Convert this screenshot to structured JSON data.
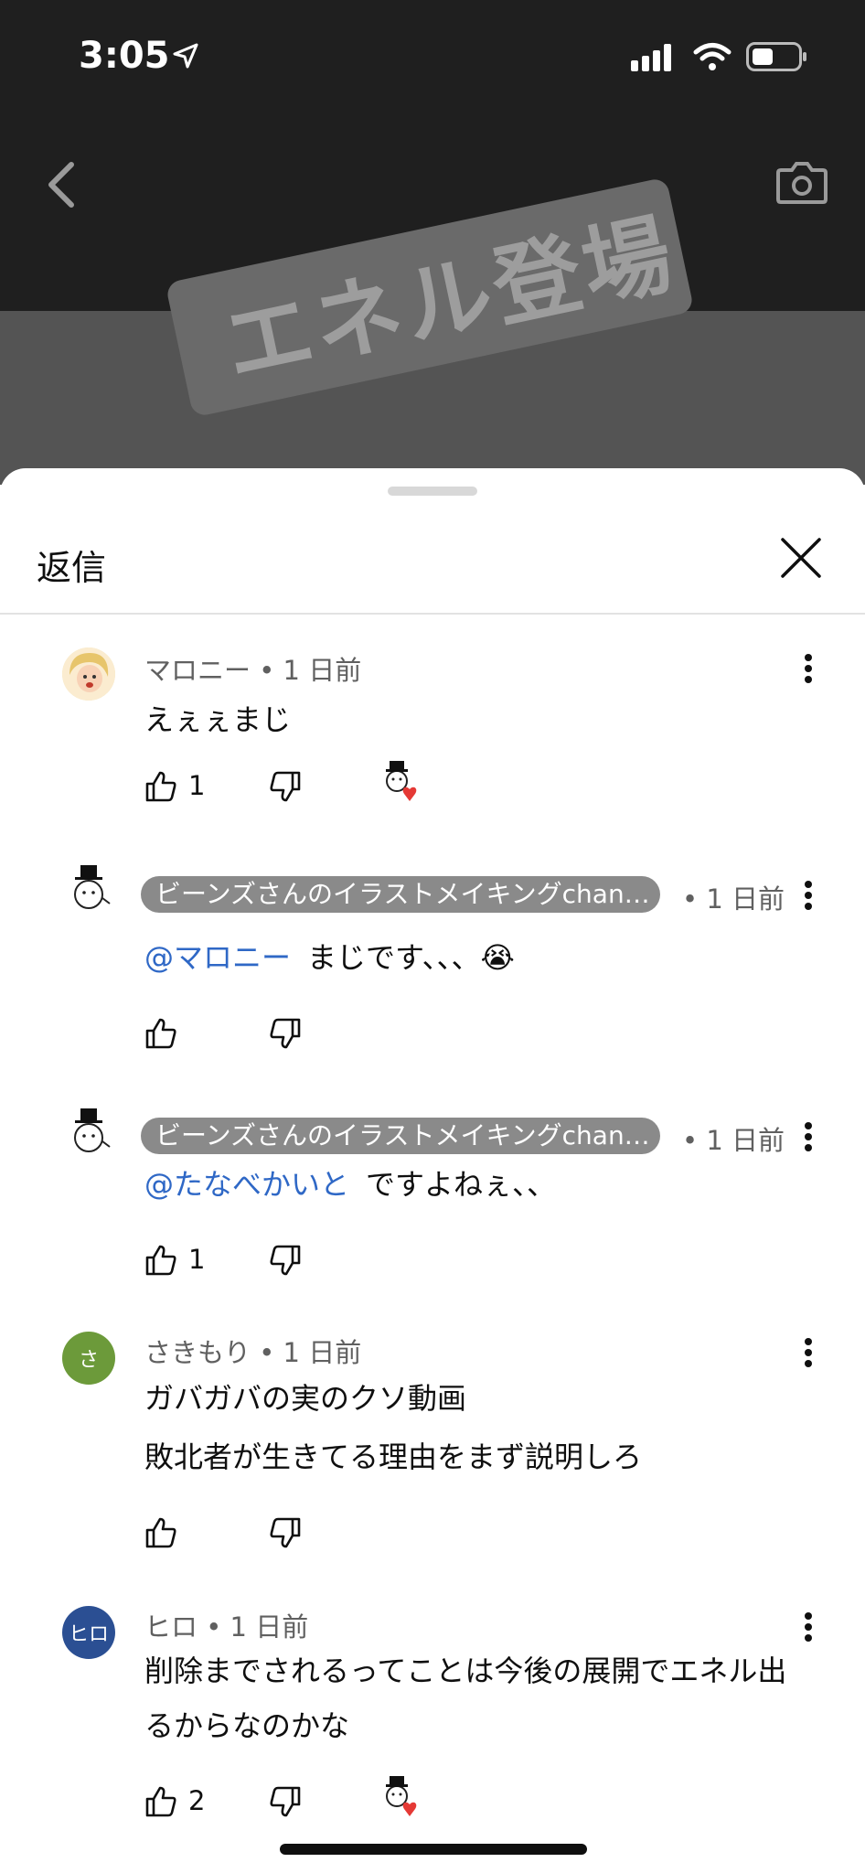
{
  "status_bar": {
    "time": "3:05"
  },
  "video": {
    "overlay_text": "エネル登場"
  },
  "sheet": {
    "title": "返信"
  },
  "comments": [
    {
      "author": "マロニー",
      "age": "• 1 日前",
      "mention": "",
      "text": "えぇぇまじ",
      "likes": "1",
      "creator_heart": true
    },
    {
      "author": "ビーンズさんのイラストメイキングchan…",
      "age": "• 1 日前",
      "mention": "@マロニー",
      "text": "まじです、、、😭",
      "likes": "",
      "creator_heart": false
    },
    {
      "author": "ビーンズさんのイラストメイキングchan…",
      "age": "• 1 日前",
      "mention": "@たなべかいと",
      "text": "ですよねぇ、、",
      "likes": "1",
      "creator_heart": false
    },
    {
      "author": "さきもり",
      "age": "• 1 日前",
      "mention": "",
      "text": "ガバガバの実のクソ動画",
      "text2": "敗北者が生きてる理由をまず説明しろ",
      "likes": "",
      "creator_heart": false,
      "avatar_letter": "さ",
      "avatar_color": "#6c9a3a"
    },
    {
      "author": "ヒロ",
      "age": "• 1 日前",
      "mention": "",
      "text": "削除までされるってことは今後の展開でエネル出",
      "text2": "るからなのかな",
      "likes": "2",
      "creator_heart": true,
      "avatar_letter": "ヒロ",
      "avatar_color": "#2b4f93"
    }
  ],
  "colors": {
    "mention": "#2f68c6",
    "pill": "#8a8a8a",
    "heart": "#e53935"
  }
}
